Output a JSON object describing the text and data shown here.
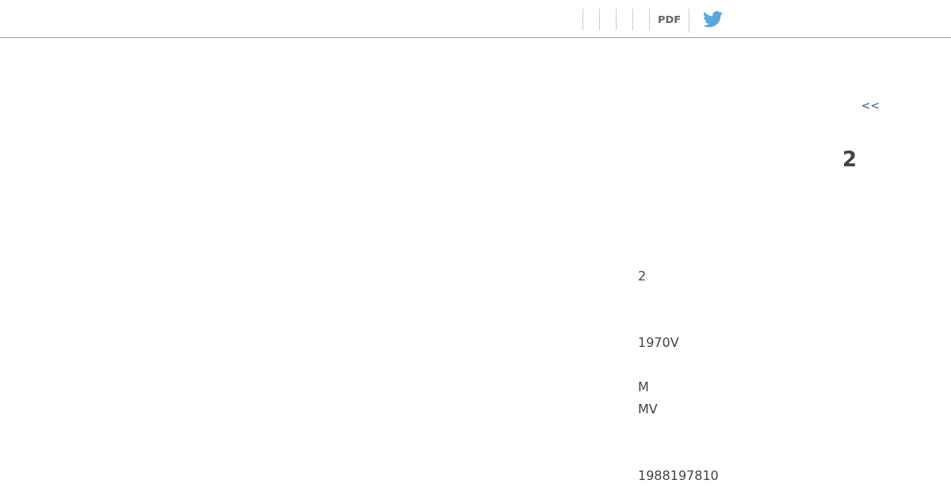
{
  "toolbar": {
    "pdf_link": "PDF"
  },
  "back_link": "<<",
  "heading": "2",
  "lines": [
    "2",
    "1970V",
    "M",
    "MV",
    "1988197810"
  ]
}
